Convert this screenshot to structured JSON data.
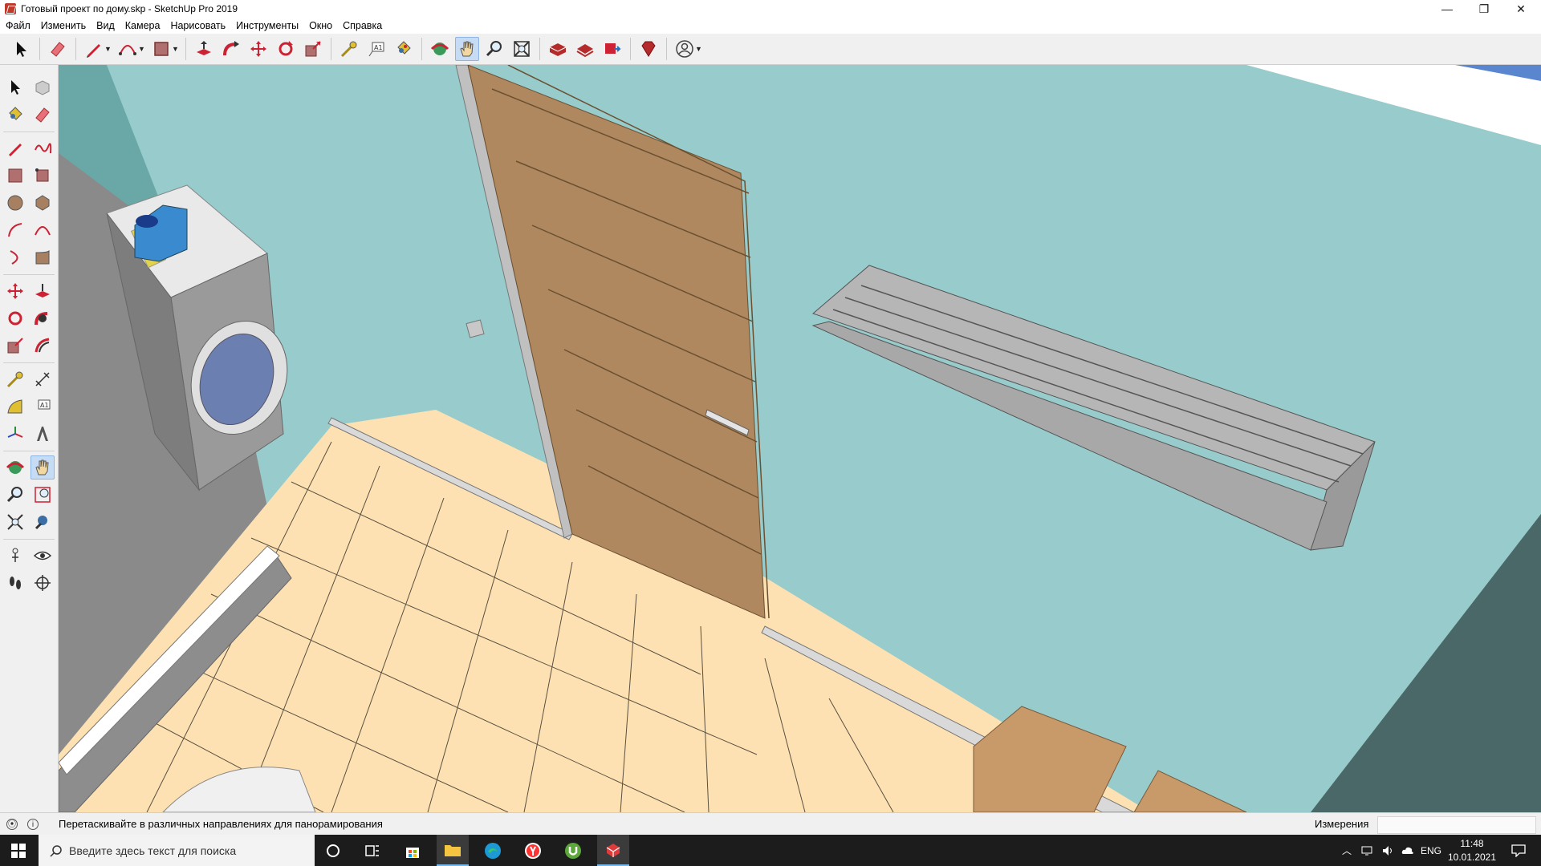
{
  "window": {
    "title": "Готовый проект по дому.skp - SketchUp Pro 2019",
    "controls": {
      "minimize": "—",
      "restore": "❐",
      "close": "✕"
    }
  },
  "menu": {
    "items": [
      "Файл",
      "Изменить",
      "Вид",
      "Камера",
      "Нарисовать",
      "Инструменты",
      "Окно",
      "Справка"
    ]
  },
  "toolbar": {
    "tools": [
      "select",
      "eraser",
      "line",
      "arc",
      "rectangle",
      "push-pull",
      "follow-me",
      "move",
      "rotate",
      "scale",
      "tape-measure",
      "text",
      "paint-bucket",
      "orbit",
      "pan",
      "zoom",
      "zoom-extents",
      "3d-warehouse",
      "extension-warehouse",
      "layout",
      "extension-manager",
      "account"
    ],
    "active_tool": "pan"
  },
  "left_toolbar": {
    "active_tool": "pan"
  },
  "status": {
    "hint": "Перетаскивайте в различных направлениях для панорамирования",
    "measurements_label": "Измерения",
    "measurements_value": ""
  },
  "taskbar": {
    "search_placeholder": "Введите здесь текст для поиска",
    "language": "ENG",
    "time": "11:48",
    "date": "10.01.2021"
  },
  "colors": {
    "wall": "#98cbcb",
    "floor": "#fde1b2",
    "door": "#b08860",
    "accent": "#c6dcf5"
  }
}
